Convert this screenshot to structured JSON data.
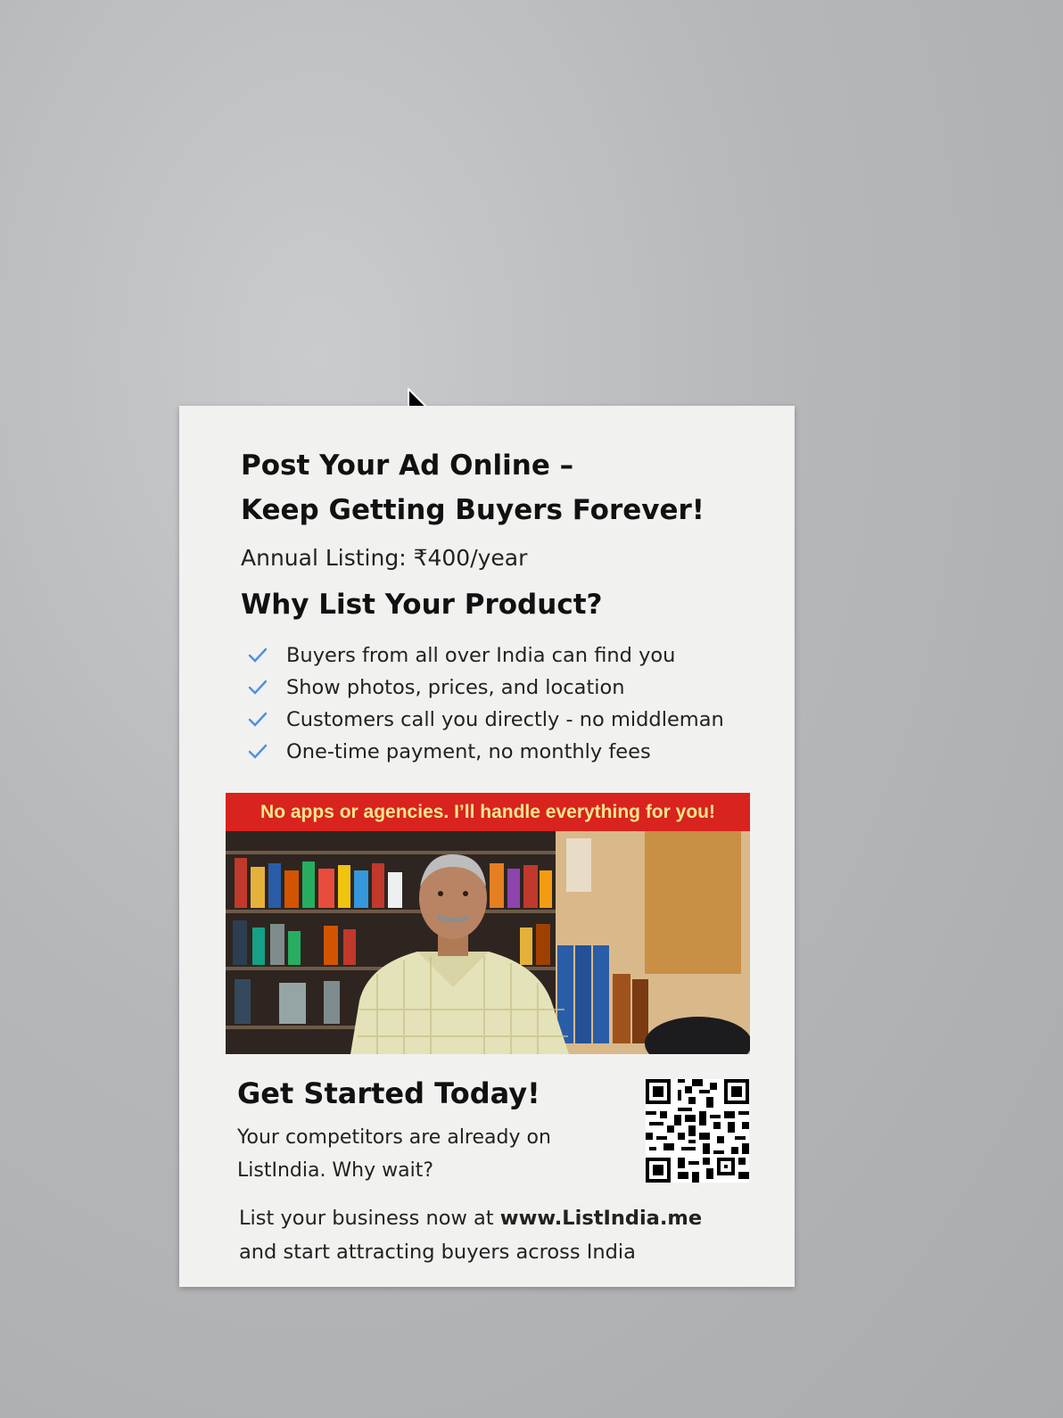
{
  "flyer": {
    "headline_line1": "Post Your Ad Online –",
    "headline_line2": "Keep Getting Buyers Forever!",
    "pricing": "Annual Listing: ₹400/year",
    "why_title": "Why List Your Product?",
    "benefits": [
      "Buyers from all over India can find you",
      "Show photos, prices, and location",
      "Customers call you directly - no middleman",
      "One-time payment, no monthly fees"
    ],
    "banner": "No apps or agencies. I’ll handle everything for you!",
    "cta_title": "Get Started Today!",
    "cta_line1": "Your competitors are already on",
    "cta_line2": "ListIndia. Why wait?",
    "list_prefix": "List your business now at ",
    "website": "www.ListIndia.me",
    "list_suffix": "and start attracting buyers across India"
  },
  "colors": {
    "banner_bg": "#d8231f",
    "banner_text": "#fbe68b",
    "check": "#4a90e2"
  },
  "icons": {
    "cursor": "mouse-pointer-icon",
    "check": "check-icon",
    "qr": "qr-code"
  }
}
